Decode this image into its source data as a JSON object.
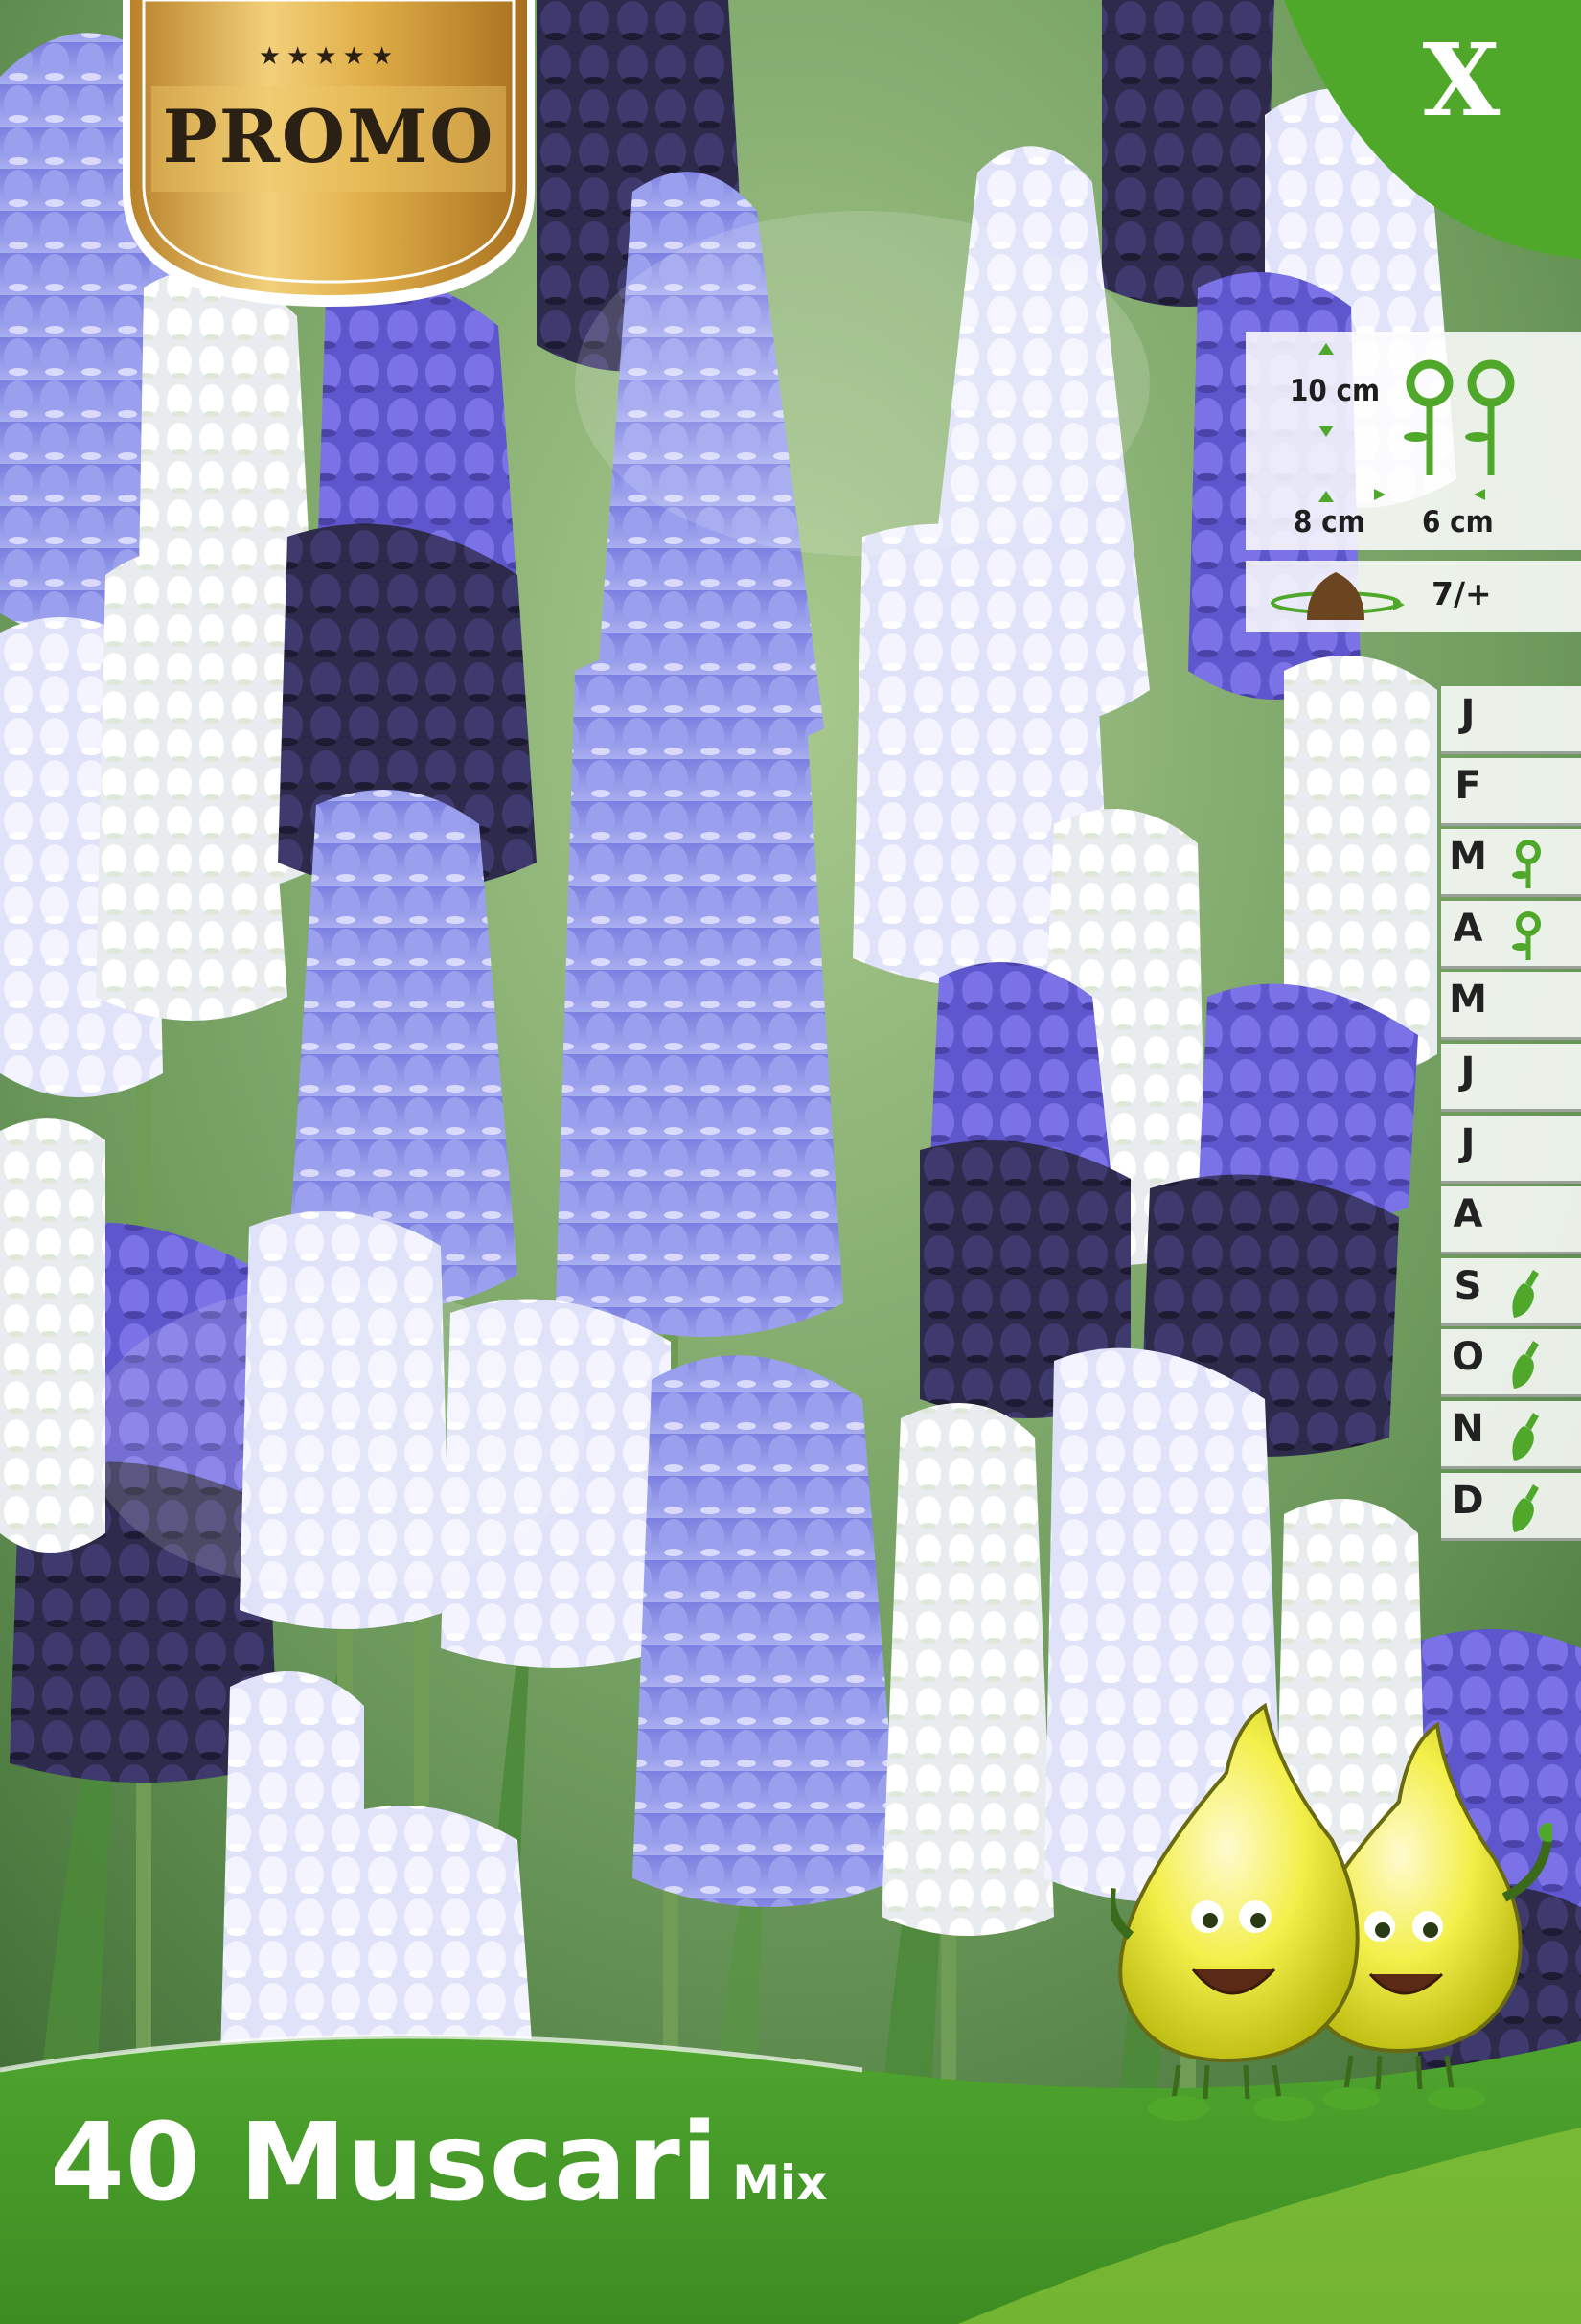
{
  "badge": {
    "stars": "★★★★★",
    "label": "PROMO"
  },
  "category": {
    "letter": "X"
  },
  "planting": {
    "depth": "10 cm",
    "spacing_row": "8 cm",
    "spacing_plant": "6 cm",
    "bulb_size": "7/+"
  },
  "calendar": {
    "months": [
      {
        "label": "J",
        "marker": "none"
      },
      {
        "label": "F",
        "marker": "none"
      },
      {
        "label": "M",
        "marker": "flower-icon"
      },
      {
        "label": "A",
        "marker": "flower-icon"
      },
      {
        "label": "M",
        "marker": "none"
      },
      {
        "label": "J",
        "marker": "none"
      },
      {
        "label": "J",
        "marker": "none"
      },
      {
        "label": "A",
        "marker": "none"
      },
      {
        "label": "S",
        "marker": "trowel-icon"
      },
      {
        "label": "O",
        "marker": "trowel-icon"
      },
      {
        "label": "N",
        "marker": "trowel-icon"
      },
      {
        "label": "D",
        "marker": "trowel-icon"
      }
    ]
  },
  "product": {
    "name": "40 Muscari",
    "variant": "Mix"
  },
  "colors": {
    "brand_green": "#4fa82a",
    "gold": "#d9a93c",
    "flower_blue": "#8a8fe6",
    "flower_dark": "#2f2b55"
  }
}
